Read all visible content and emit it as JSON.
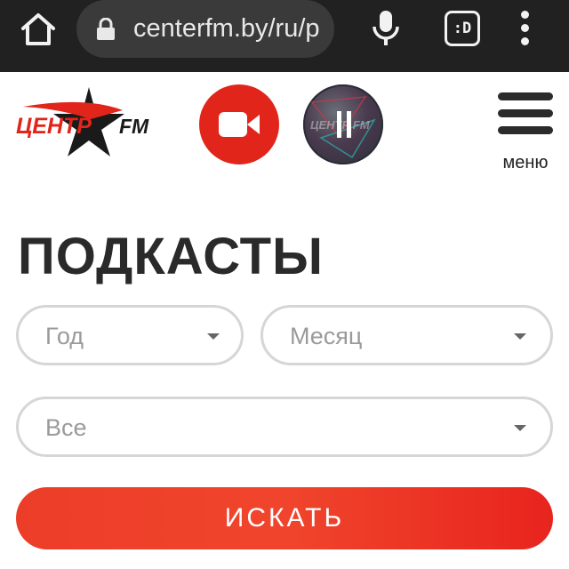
{
  "browser": {
    "url": "centerfm.by/ru/p",
    "extension_label": ":D",
    "icons": [
      "home-icon",
      "lock-icon",
      "mic-icon",
      "extension-icon",
      "kebab-menu-icon"
    ]
  },
  "header": {
    "logo_text": "ЦЕНТР",
    "logo_fm": "FM",
    "menu_label": "меню",
    "accent_color": "#e1251b",
    "icons": [
      "video-camera-icon",
      "pause-icon",
      "hamburger-icon"
    ]
  },
  "page": {
    "title": "ПОДКАСТЫ"
  },
  "filters": {
    "year_placeholder": "Год",
    "month_placeholder": "Месяц",
    "type_value": "Все"
  },
  "search_button": {
    "label": "ИСКАТЬ"
  }
}
